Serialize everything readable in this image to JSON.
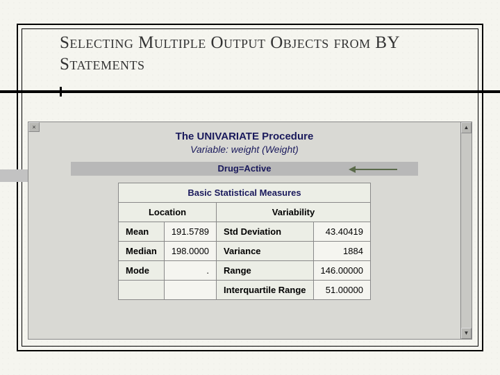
{
  "slide": {
    "title": "Selecting Multiple Output Objects from BY Statements"
  },
  "output": {
    "proc_title": "The UNIVARIATE Procedure",
    "proc_sub": "Variable: weight (Weight)",
    "by_group": "Drug=Active",
    "table_title": "Basic Statistical Measures",
    "col_headers": {
      "location": "Location",
      "variability": "Variability"
    },
    "rows": [
      {
        "loc_label": "Mean",
        "loc_value": "191.5789",
        "var_label": "Std Deviation",
        "var_value": "43.40419"
      },
      {
        "loc_label": "Median",
        "loc_value": "198.0000",
        "var_label": "Variance",
        "var_value": "1884"
      },
      {
        "loc_label": "Mode",
        "loc_value": ".",
        "var_label": "Range",
        "var_value": "146.00000"
      },
      {
        "loc_label": "",
        "loc_value": "",
        "var_label": "Interquartile Range",
        "var_value": "51.00000"
      }
    ]
  },
  "chart_data": {
    "type": "table",
    "title": "Basic Statistical Measures",
    "by_group": "Drug=Active",
    "variable": "weight (Weight)",
    "location": {
      "Mean": 191.5789,
      "Median": 198.0,
      "Mode": null
    },
    "variability": {
      "Std Deviation": 43.40419,
      "Variance": 1884,
      "Range": 146.0,
      "Interquartile Range": 51.0
    }
  }
}
